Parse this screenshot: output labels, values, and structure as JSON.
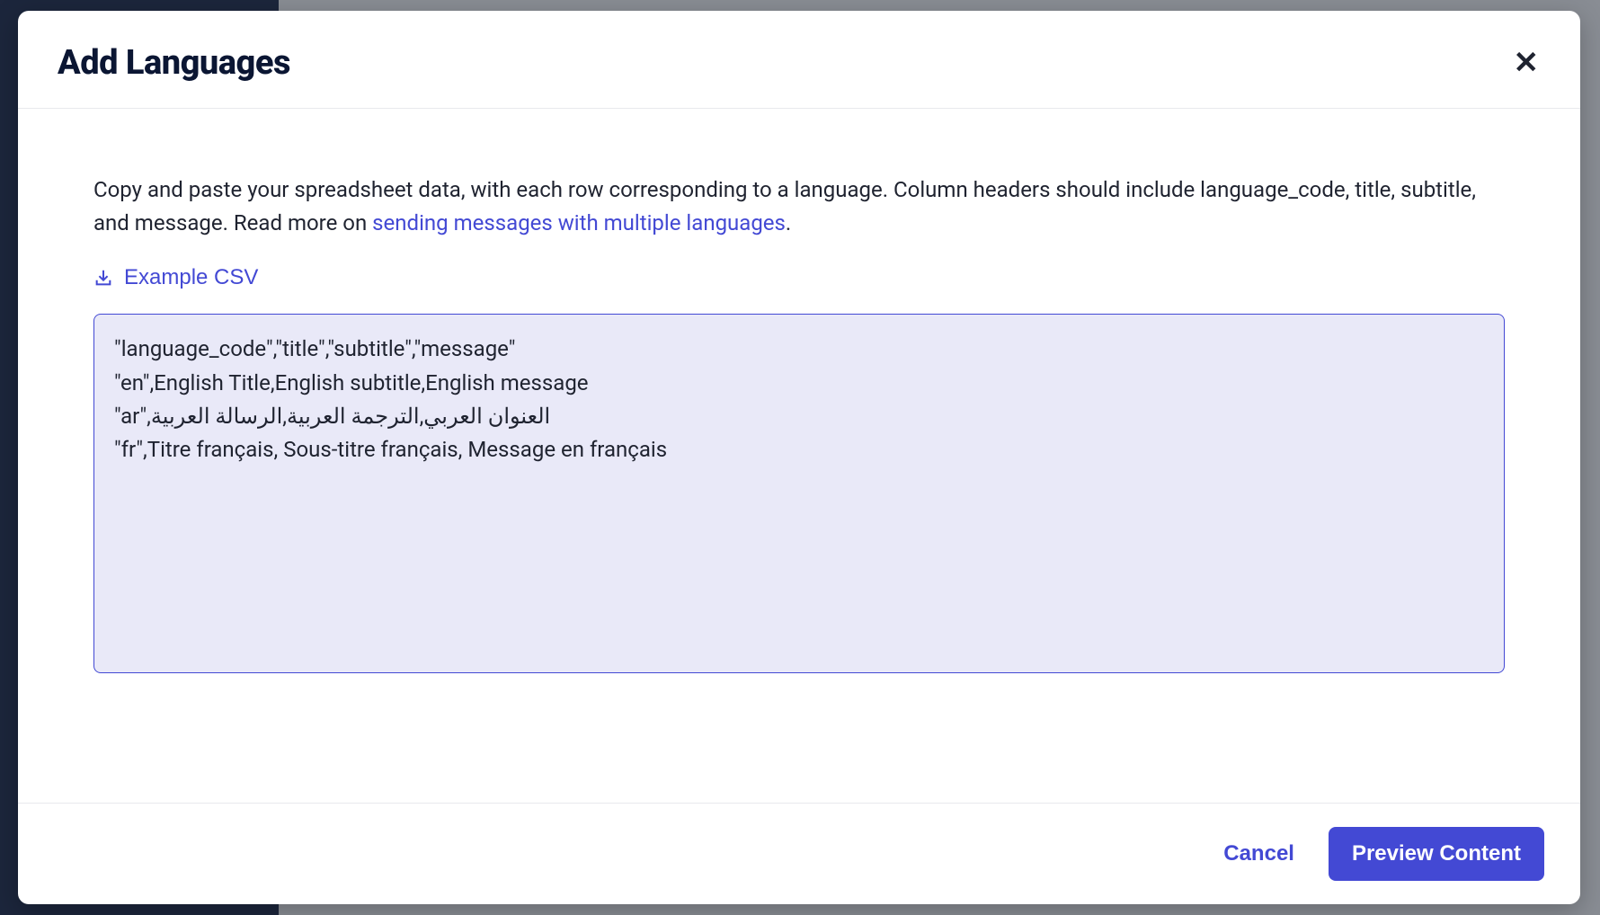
{
  "modal": {
    "title": "Add Languages",
    "instruction_prefix": "Copy and paste your spreadsheet data, with each row corresponding to a language. Column headers should include language_code, title, subtitle, and message. Read more on ",
    "instruction_link_text": "sending messages with multiple languages",
    "instruction_suffix": ".",
    "example_csv_label": "Example CSV",
    "textarea_value": "\"language_code\",\"title\",\"subtitle\",\"message\"\n\"en\",English Title,English subtitle,English message\n\"ar\",العنوان العربي,الترجمة العربية,الرسالة العربية\n\"fr\",Titre français, Sous-titre français, Message en français",
    "cancel_label": "Cancel",
    "preview_label": "Preview Content"
  }
}
